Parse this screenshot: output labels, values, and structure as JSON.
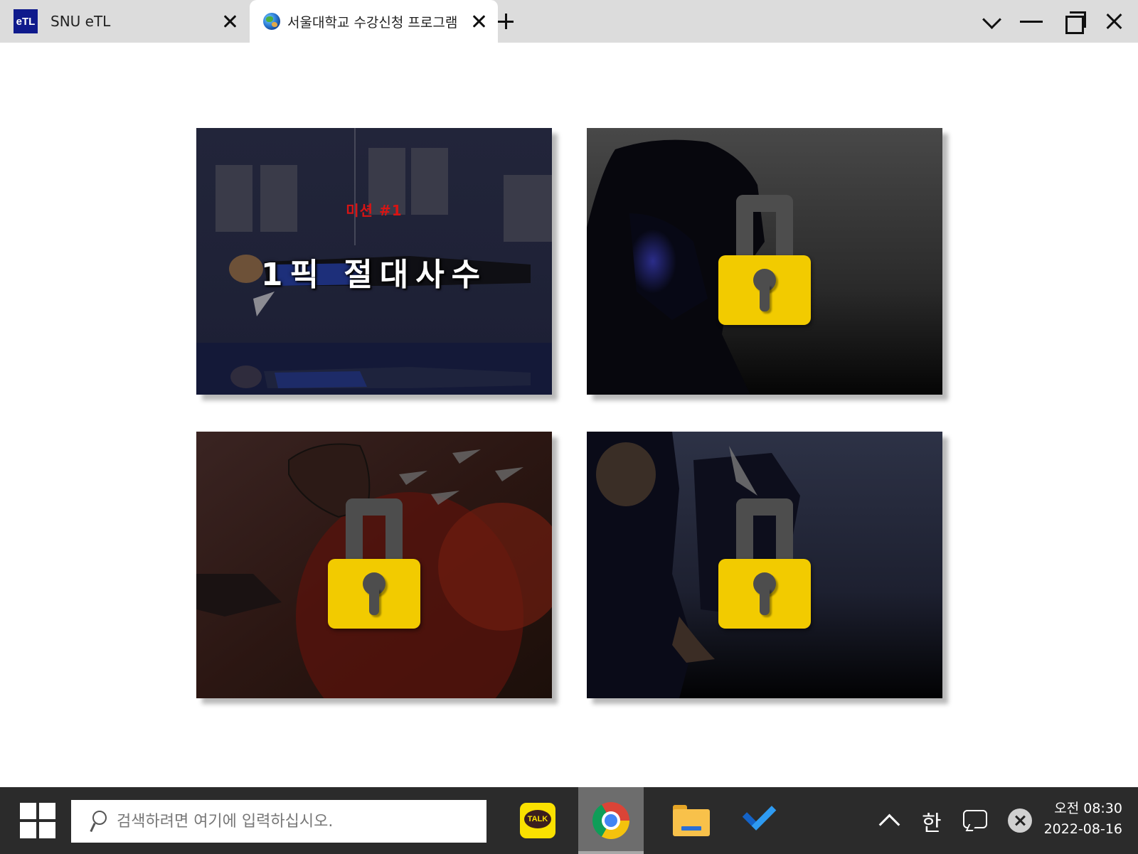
{
  "tabs": [
    {
      "title": "SNU eTL",
      "favicon_text": "eTL",
      "favicon_color": "#0f1a8c"
    },
    {
      "title": "서울대학교 수강신청 프로그램",
      "favicon": "globe-icon",
      "active": true
    }
  ],
  "window_controls": [
    "chevron-down-icon",
    "minimize-icon",
    "maximize-icon",
    "close-icon"
  ],
  "missions": [
    {
      "label": "미션 #1",
      "title": "1픽 절대사수",
      "locked": false
    },
    {
      "locked": true
    },
    {
      "locked": true
    },
    {
      "locked": true
    }
  ],
  "colors": {
    "lock_body": "#f2cb00",
    "lock_shackle": "#4d4d4d",
    "mission_label": "#d81414",
    "taskbar": "#2b2b2b"
  },
  "taskbar": {
    "search_placeholder": "검색하려면 여기에 입력하십시오.",
    "apps": [
      {
        "name": "KakaoTalk",
        "icon": "kakaotalk-icon",
        "icon_text": "TALK"
      },
      {
        "name": "Chrome",
        "icon": "chrome-icon",
        "active": true
      },
      {
        "name": "File Explorer",
        "icon": "folder-icon"
      },
      {
        "name": "To Do",
        "icon": "checkmark-icon"
      }
    ],
    "ime_label": "한",
    "time": "오전 08:30",
    "date": "2022-08-16"
  }
}
